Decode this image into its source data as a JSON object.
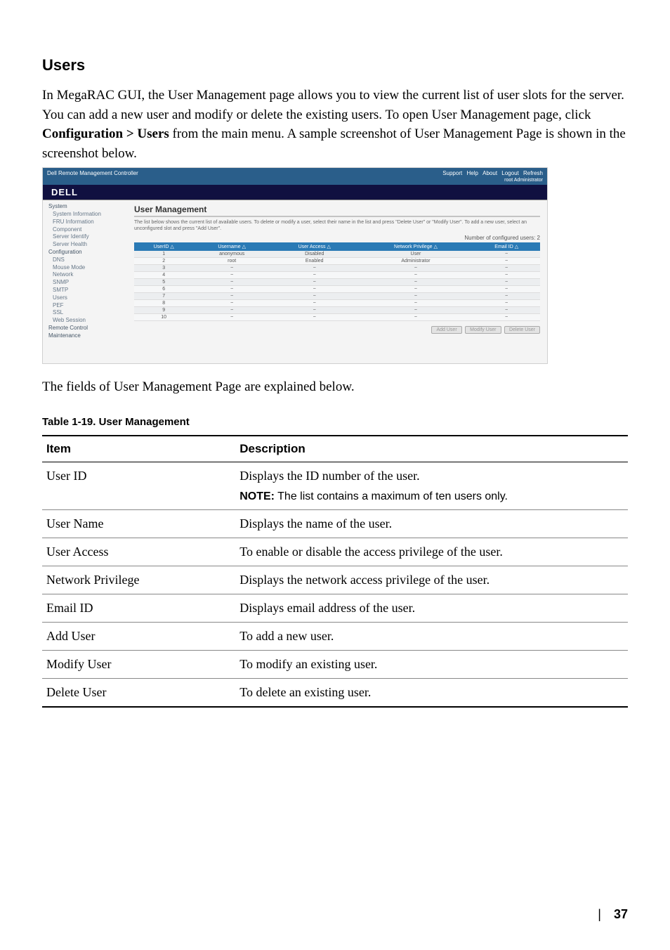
{
  "doc": {
    "section_title": "Users",
    "para": "In MegaRAC GUI, the User Management page allows you to view the current list of user slots for the server. You can add a new user and modify or delete the existing users. To open User Management page, click ",
    "para_bold": "Configuration > Users",
    "para_tail": " from the main menu. A sample screenshot of User Management Page is shown in the screenshot below.",
    "after_text": "The fields of User Management Page are explained below.",
    "table_caption": "Table 1-19.   User Management",
    "headers": {
      "item": "Item",
      "desc": "Description"
    },
    "rows": [
      {
        "item": "User ID",
        "desc": "Displays the ID number of the user.",
        "note": "NOTE:",
        "note_text": " The list contains a maximum of ten users only."
      },
      {
        "item": "User Name",
        "desc": "Displays the name of the user."
      },
      {
        "item": "User Access",
        "desc": "To enable or disable the access privilege of the user."
      },
      {
        "item": "Network Privilege",
        "desc": "Displays the network access privilege of the user."
      },
      {
        "item": "Email ID",
        "desc": "Displays email address of the user."
      },
      {
        "item": "Add User",
        "desc": "To add a new user."
      },
      {
        "item": "Modify User",
        "desc": "To modify an existing user."
      },
      {
        "item": "Delete User",
        "desc": "To delete an existing user."
      }
    ],
    "page_number": "37"
  },
  "shot": {
    "window_title": "Dell Remote Management Controller",
    "toplinks": [
      "Support",
      "Help",
      "About",
      "Logout",
      "Refresh"
    ],
    "login_as": "root Administrator",
    "brand": "DELL",
    "nav": {
      "system": "System",
      "items1": [
        "System Information",
        "FRU Information",
        "Component",
        "Server Identify",
        "Server Health"
      ],
      "config": "Configuration",
      "items2": [
        "DNS",
        "Mouse Mode",
        "Network",
        "SNMP",
        "SMTP",
        "Users",
        "PEF",
        "SSL",
        "Web Session"
      ],
      "remote": "Remote Control",
      "maint": "Maintenance"
    },
    "main": {
      "title": "User Management",
      "desc": "The list below shows the current list of available users. To delete or modify a user, select their name in the list and press \"Delete User\" or \"Modify User\". To add a new user, select an unconfigured slot and press \"Add User\".",
      "count": "Number of configured users: 2",
      "cols": [
        "UserID  △",
        "Username  △",
        "User Access  △",
        "Network Privilege  △",
        "Email ID  △"
      ],
      "rows": [
        [
          "1",
          "anonymous",
          "Disabled",
          "User",
          "~"
        ],
        [
          "2",
          "root",
          "Enabled",
          "Administrator",
          "~"
        ],
        [
          "3",
          "~",
          "~",
          "~",
          "~"
        ],
        [
          "4",
          "~",
          "~",
          "~",
          "~"
        ],
        [
          "5",
          "~",
          "~",
          "~",
          "~"
        ],
        [
          "6",
          "~",
          "~",
          "~",
          "~"
        ],
        [
          "7",
          "~",
          "~",
          "~",
          "~"
        ],
        [
          "8",
          "~",
          "~",
          "~",
          "~"
        ],
        [
          "9",
          "~",
          "~",
          "~",
          "~"
        ],
        [
          "10",
          "~",
          "~",
          "~",
          "~"
        ]
      ],
      "btns": [
        "Add User",
        "Modify User",
        "Delete User"
      ]
    }
  }
}
